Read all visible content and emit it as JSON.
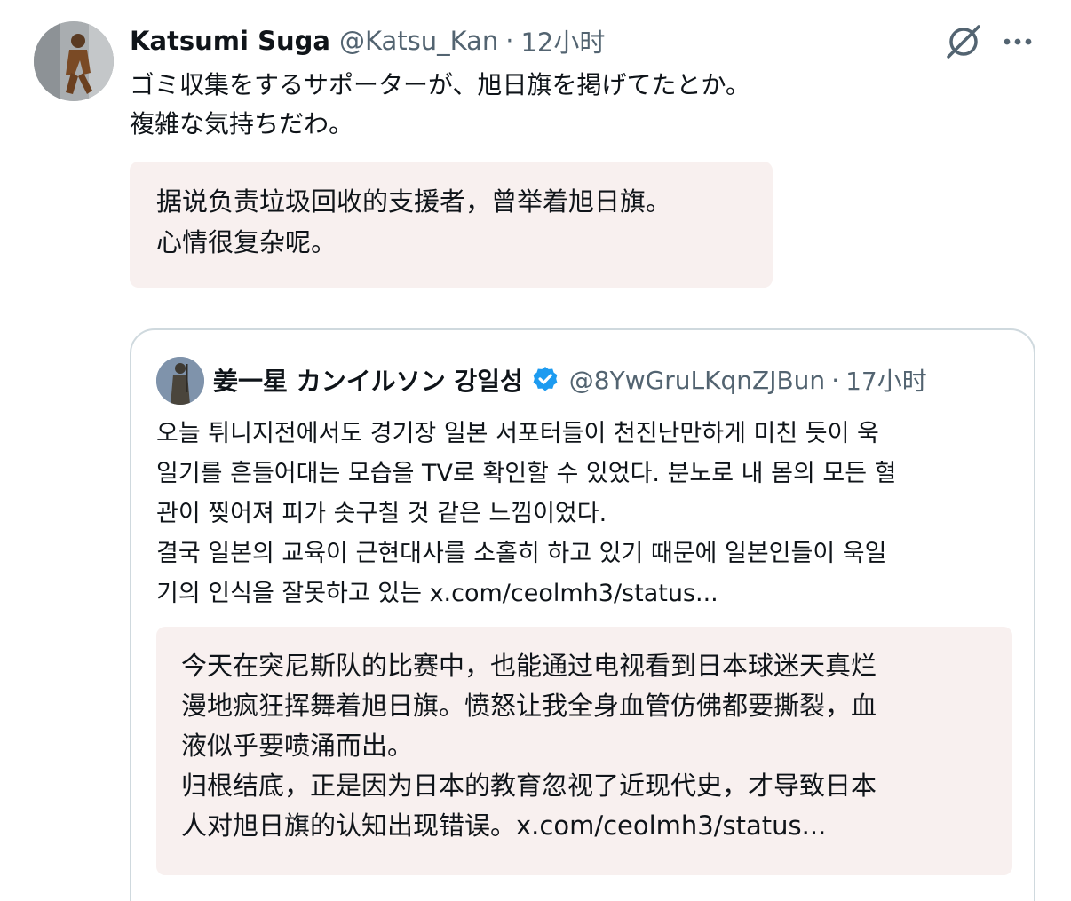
{
  "tweet": {
    "author_name": "Katsumi Suga",
    "author_handle": "@Katsu_Kan",
    "separator": "·",
    "time": "12小时",
    "text_lines": [
      "ゴミ収集をするサポーターが、旭日旗を掲げてたとか。",
      "複雑な気持ちだわ。"
    ],
    "translation_lines": [
      "据说负责垃圾回收的支援者，曾举着旭日旗。",
      "心情很复杂呢。"
    ],
    "icons": {
      "grok": "grok-slashed-circle-icon",
      "more": "more-dots-icon",
      "avatar": "avatar-figure-icon"
    }
  },
  "quoted": {
    "author_name": "姜一星 カンイルソン 강일성",
    "author_handle": "@8YwGruLKqnZJBun",
    "separator": "·",
    "time": "17小时",
    "verified_color": "#1d9bf0",
    "text_lines": [
      "오늘 튀니지전에서도 경기장 일본 서포터들이 천진난만하게 미친 듯이 욱",
      "일기를 흔들어대는 모습을 TV로 확인할 수 있었다. 분노로 내 몸의 모든 혈",
      "관이 찢어져 피가 솟구칠 것 같은 느낌이었다.",
      "결국 일본의 교육이 근현대사를 소홀히 하고 있기 때문에 일본인들이 욱일",
      "기의 인식을 잘못하고 있는 x.com/ceolmh3/status..."
    ],
    "translation_lines": [
      "今天在突尼斯队的比赛中，也能通过电视看到日本球迷天真烂",
      "漫地疯狂挥舞着旭日旗。愤怒让我全身血管仿佛都要撕裂，血",
      "液似乎要喷涌而出。",
      "归根结底，正是因为日本的教育忽视了近现代史，才导致日本",
      "人对旭日旗的认知出现错误。x.com/ceolmh3/status..."
    ]
  },
  "colors": {
    "text": "#0f1419",
    "secondary": "#536471",
    "translation_bg": "#f8f0ef",
    "border": "#cfd9de"
  }
}
